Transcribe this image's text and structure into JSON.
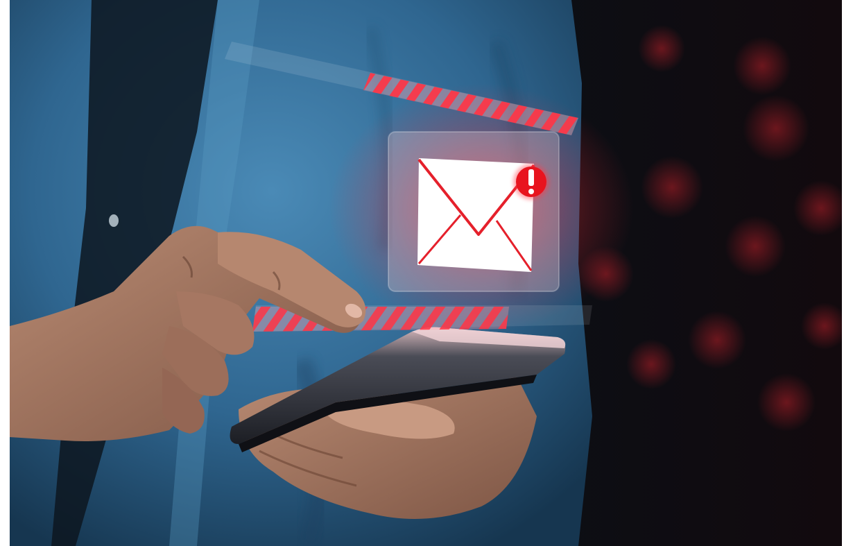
{
  "image": {
    "subject": "hand-tapping-smartphone-with-email-alert",
    "icons": [
      "envelope-icon",
      "alert-exclamation-badge-icon"
    ],
    "alert_badge_glyph": "!",
    "colors": {
      "shirt": "#3d7aa6",
      "shirt_dark": "#1f4a6b",
      "background": "#0a0c12",
      "alert_red": "#e8141e",
      "glow_red": "#ff3040",
      "skin": "#a57862",
      "phone": "#2a2c33"
    }
  }
}
